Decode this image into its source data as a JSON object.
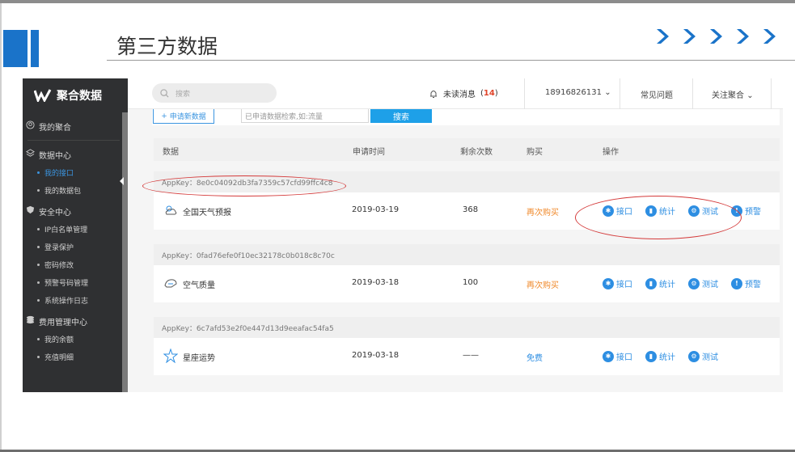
{
  "slide": {
    "title": "第三方数据"
  },
  "sidebar": {
    "logo": "聚合数据",
    "groups": [
      {
        "label": "我的聚合",
        "icon": "user-icon",
        "items": []
      },
      {
        "label": "数据中心",
        "icon": "layers-icon",
        "items": [
          {
            "label": "我的接口",
            "active": true
          },
          {
            "label": "我的数据包",
            "active": false
          }
        ]
      },
      {
        "label": "安全中心",
        "icon": "shield-icon",
        "items": [
          {
            "label": "IP白名单管理"
          },
          {
            "label": "登录保护"
          },
          {
            "label": "密码修改"
          },
          {
            "label": "预警号码管理"
          },
          {
            "label": "系统操作日志"
          }
        ]
      },
      {
        "label": "费用管理中心",
        "icon": "coins-icon",
        "items": [
          {
            "label": "我的余额"
          },
          {
            "label": "充值明细"
          }
        ]
      }
    ]
  },
  "header": {
    "search_placeholder": "搜索",
    "messages_label": "未读消息",
    "messages_count": "14",
    "phone": "18916826131",
    "faq": "常见问题",
    "follow": "关注聚合"
  },
  "toolbar": {
    "apply_label": "申请新数据",
    "filter_placeholder": "已申请数据检索,如:流量",
    "search_label": "搜索"
  },
  "table": {
    "headers": [
      "数据",
      "申请时间",
      "剩余次数",
      "购买",
      "操作"
    ],
    "rows": [
      {
        "appkey": "AppKey：8e0c04092db3fa7359c57cfd99ffc4c8",
        "name": "全国天气预报",
        "icon": "weather-icon",
        "date": "2019-03-19",
        "remaining": "368",
        "buy": "再次购买",
        "buy_color": "#f08a2c",
        "ops": [
          "接口",
          "统计",
          "测试",
          "预警"
        ]
      },
      {
        "appkey": "AppKey：0fad76efe0f10ec32178c0b018c8c70c",
        "name": "空气质量",
        "icon": "air-icon",
        "date": "2019-03-18",
        "remaining": "100",
        "buy": "再次购买",
        "buy_color": "#f08a2c",
        "ops": [
          "接口",
          "统计",
          "测试",
          "预警"
        ]
      },
      {
        "appkey": "AppKey：6c7afd53e2f0e447d13d9eeafac54fa5",
        "name": "星座运势",
        "icon": "star-icon",
        "date": "2019-03-18",
        "remaining": "——",
        "buy": "免费",
        "buy_color": "#2d8ee2",
        "ops": [
          "接口",
          "统计",
          "测试"
        ]
      }
    ]
  },
  "colors": {
    "accent": "#2d8ee2",
    "sidebar_bg": "#2f3032",
    "annotation": "#d43a3a",
    "deco_blue": "#1a73c9"
  }
}
